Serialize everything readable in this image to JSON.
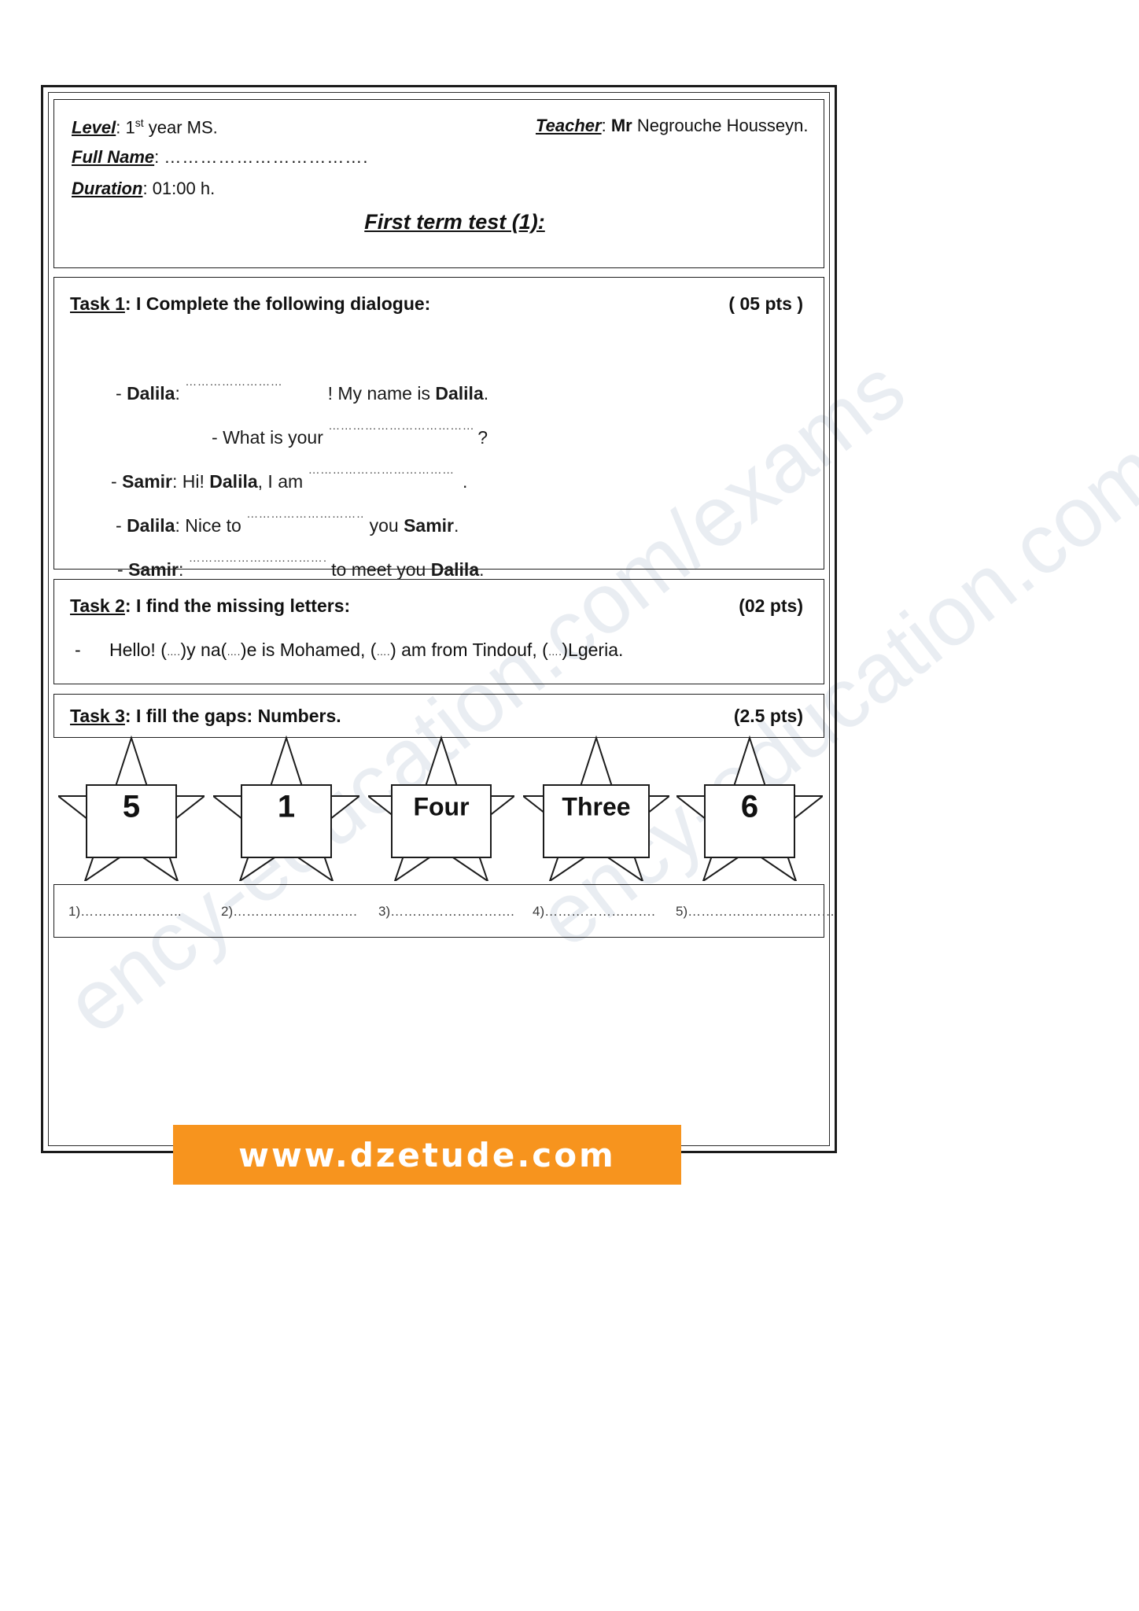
{
  "watermarks": {
    "line1": "ency-education.com/exams",
    "line2": "ency-education.com/exams"
  },
  "header": {
    "level_label": "Level",
    "level_value_pre": "1",
    "level_value_sup": "st",
    "level_value_post": "year MS.",
    "teacher_label": "Teacher",
    "teacher_title": "Mr",
    "teacher_name": "Negrouche Housseyn.",
    "fullname_label": "Full Name",
    "fullname_dots": "…………………………….",
    "duration_label": "Duration",
    "duration_value": "01:00 h.",
    "title": "First term test (1):"
  },
  "task1": {
    "number": "Task 1",
    "instruction": ": I Complete the following dialogue:",
    "points": "( 05 pts )",
    "dialogue": [
      {
        "speaker": "Dalila",
        "dash": "-",
        "before": "",
        "blank": "……………………",
        "after": " ! My name is ",
        "bold_after": "Dalila",
        "tail": "."
      },
      {
        "speaker": "",
        "dash": "-",
        "before": "What is your ",
        "blank": "………………………………",
        "after": "",
        "bold_after": "",
        "tail": "?"
      },
      {
        "speaker": "Samir",
        "dash": "-",
        "before": "Hi! ",
        "bold_mid": "Dalila",
        "before2": ", I am ",
        "blank": "………………………………",
        "after": "",
        "bold_after": "",
        "tail": " ."
      },
      {
        "speaker": "Dalila",
        "dash": "-",
        "before": "Nice to ",
        "blank": "……………………………",
        "after": "  you ",
        "bold_after": "Samir",
        "tail": "."
      },
      {
        "speaker": "Samir",
        "dash": "-",
        "before": "",
        "blank": "………………………………",
        "after": " to meet you ",
        "bold_after": "Dalila",
        "tail": "."
      }
    ]
  },
  "task2": {
    "number": "Task 2",
    "instruction": ": I find the missing letters:",
    "points": "(02 pts)",
    "bullet": "-",
    "sentence_parts": {
      "p1": "Hello! (",
      "g1": "….",
      "p2": ")y na(",
      "g2": "….",
      "p3": ")e is Mohamed, (",
      "g3": "….",
      "p4": ") am from Tindouf, (",
      "g4": "….",
      "p5": ")Lgeria."
    }
  },
  "task3": {
    "number": "Task 3",
    "instruction": ": I fill the gaps: Numbers.",
    "points": "(2.5 pts)",
    "stars": [
      {
        "value": "5",
        "kind": "num"
      },
      {
        "value": "1",
        "kind": "num"
      },
      {
        "value": "Four",
        "kind": "word"
      },
      {
        "value": "Three",
        "kind": "word"
      },
      {
        "value": "6",
        "kind": "num"
      }
    ],
    "answers": [
      "1)…………………..",
      "2)……………………….",
      "3)……………………….",
      "4)…………………….",
      "5)……………………………"
    ]
  },
  "footer": {
    "website": "www.dzetude.com",
    "banner_color": "#f7941e"
  }
}
